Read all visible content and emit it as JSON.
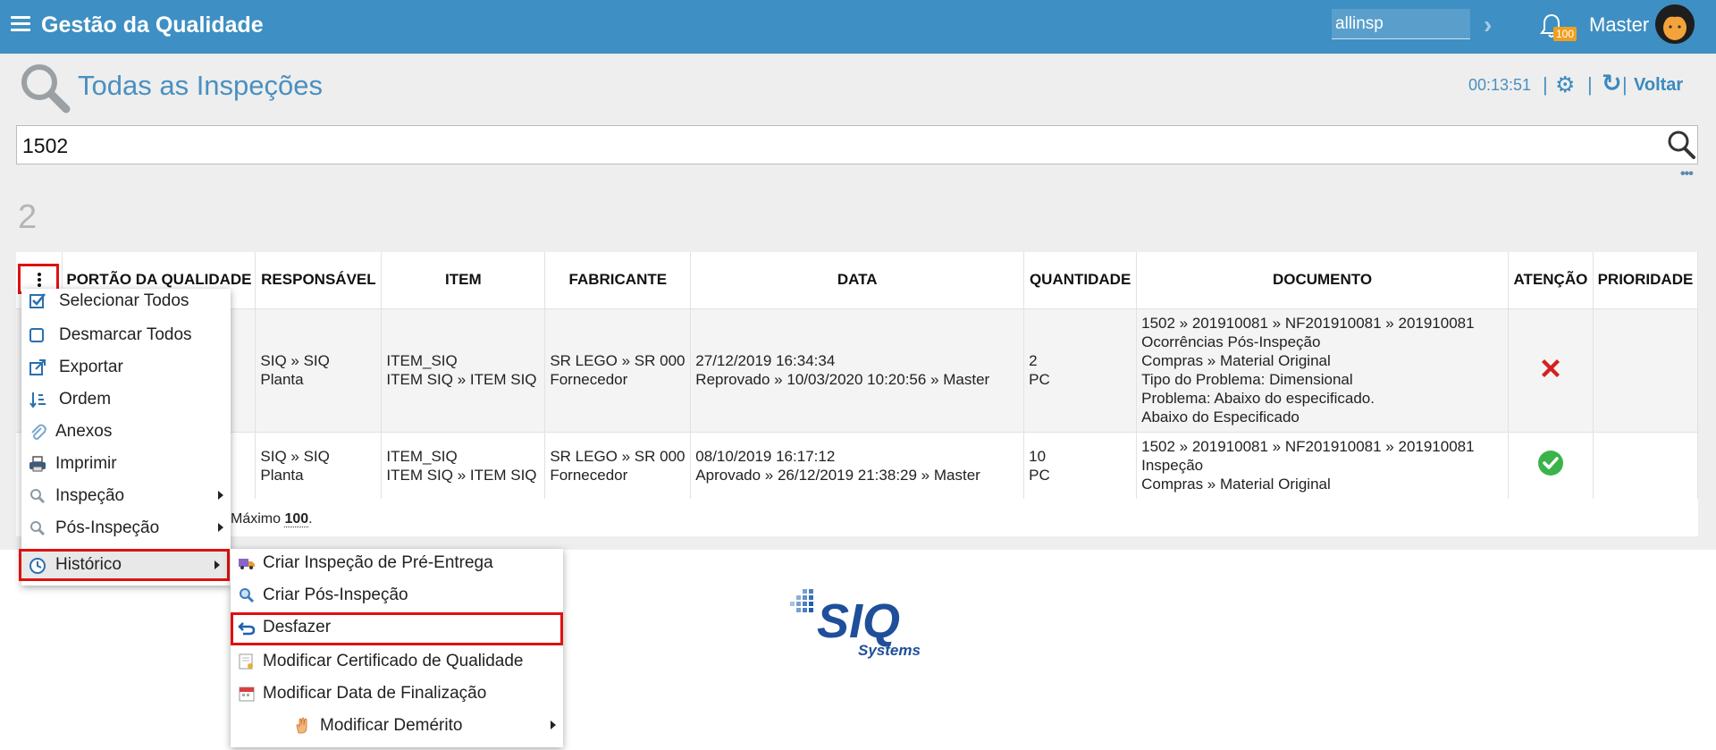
{
  "header": {
    "title": "Gestão da Qualidade",
    "search_value": "allinsp",
    "notification_count": "100",
    "user": "Master"
  },
  "page": {
    "title": "Todas as Inspeções",
    "timer": "00:13:51",
    "back_label": "Voltar",
    "search_value": "1502",
    "result_count": "2"
  },
  "table": {
    "headers": [
      "PORTÃO DA QUALIDADE",
      "RESPONSÁVEL",
      "ITEM",
      "FABRICANTE",
      "DATA",
      "QUANTIDADE",
      "DOCUMENTO",
      "ATENÇÃO",
      "PRIORIDADE"
    ],
    "rows": [
      {
        "responsavel": [
          "SIQ » SIQ",
          "Planta"
        ],
        "item": [
          "ITEM_SIQ",
          "ITEM SIQ » ITEM SIQ"
        ],
        "fabricante": [
          "SR LEGO » SR 000",
          "Fornecedor"
        ],
        "data": [
          "27/12/2019 16:34:34",
          "Reprovado » 10/03/2020 10:20:56 » Master"
        ],
        "quantidade": [
          "2",
          "PC"
        ],
        "documento": [
          "1502 » 201910081 » NF201910081 » 201910081",
          "Ocorrências Pós-Inspeção",
          "Compras » Material Original",
          "Tipo do Problema: Dimensional",
          "Problema: Abaixo do especificado.",
          "Abaixo do Especificado"
        ],
        "atencao": "rejected-icon"
      },
      {
        "responsavel": [
          "SIQ » SIQ",
          "Planta"
        ],
        "item": [
          "ITEM_SIQ",
          "ITEM SIQ » ITEM SIQ"
        ],
        "fabricante": [
          "SR LEGO » SR 000",
          "Fornecedor"
        ],
        "data": [
          "08/10/2019 16:17:12",
          "Aprovado » 26/12/2019 21:38:29 » Master"
        ],
        "quantidade": [
          "10",
          "PC"
        ],
        "documento": [
          "1502 » 201910081 » NF201910081 » 201910081",
          "Inspeção",
          "Compras » Material Original"
        ],
        "atencao": "approved-icon"
      }
    ],
    "footer_prefix": "Máximo ",
    "footer_max": "100",
    "footer_suffix": "."
  },
  "context_menu": {
    "items": [
      "Selecionar Todos",
      "Desmarcar Todos",
      "Exportar",
      "Ordem",
      "Anexos",
      "Imprimir",
      "Inspeção",
      "Pós-Inspeção",
      "Histórico"
    ]
  },
  "submenu": {
    "items": [
      "Criar Inspeção de Pré-Entrega",
      "Criar Pós-Inspeção",
      "Desfazer",
      "Modificar Certificado de Qualidade",
      "Modificar Data de Finalização",
      "Modificar Demérito"
    ]
  },
  "logo": {
    "text": "SIQ",
    "subtext": "Systems"
  },
  "colors": {
    "header_bg": "#3e8fc3",
    "accent": "#4a90c0",
    "highlight": "#e01010"
  }
}
